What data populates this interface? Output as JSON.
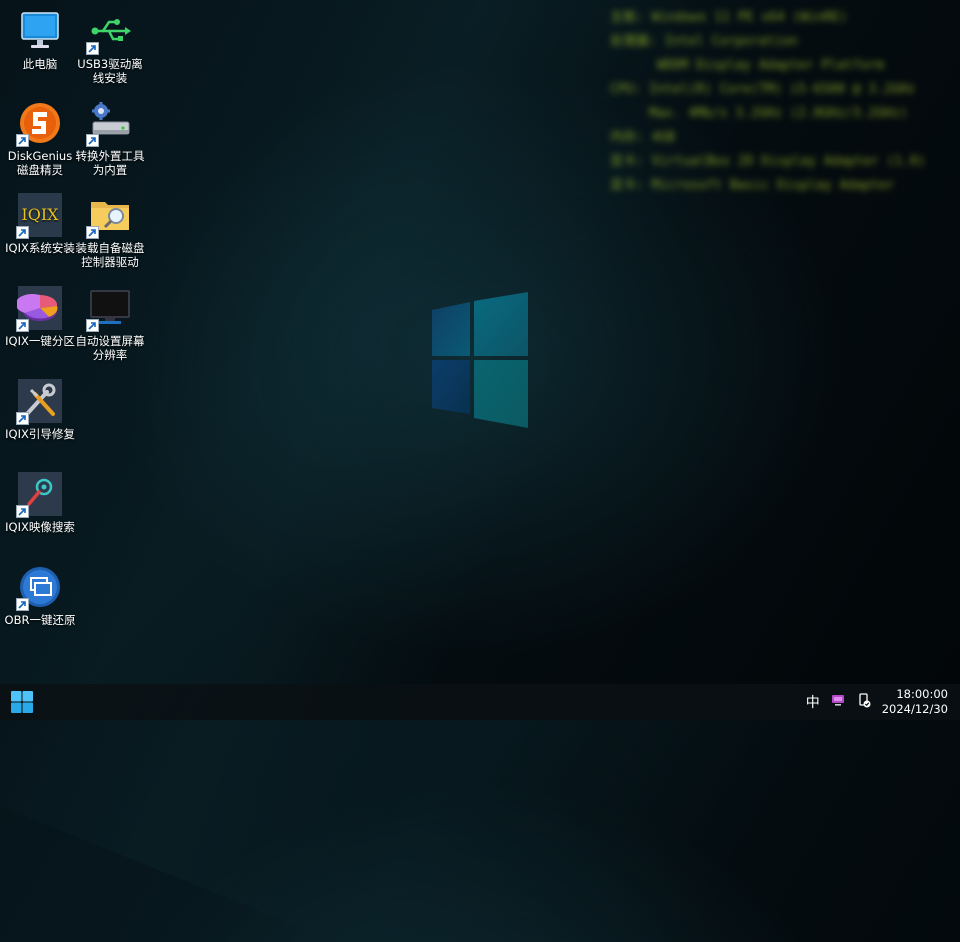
{
  "desktop": {
    "icons": [
      {
        "id": "this-pc",
        "label": "此电脑",
        "icon": "monitor-icon",
        "shortcut": false
      },
      {
        "id": "usb3",
        "label": "USB3驱动离\n线安装",
        "icon": "usb-icon",
        "shortcut": true
      },
      {
        "id": "diskgenius",
        "label": "DiskGenius\n磁盘精灵",
        "icon": "diskgenius-icon",
        "shortcut": true
      },
      {
        "id": "convert-external",
        "label": "转换外置工具\n为内置",
        "icon": "drive-gear-icon",
        "shortcut": true
      },
      {
        "id": "iqix-install",
        "label": "IQIX系统安装",
        "icon": "iqix-icon",
        "shortcut": true
      },
      {
        "id": "load-driver",
        "label": "装载自备磁盘\n控制器驱动",
        "icon": "folder-search-icon",
        "shortcut": true
      },
      {
        "id": "iqix-partition",
        "label": "IQIX一键分区",
        "icon": "pie-chart-icon",
        "shortcut": true
      },
      {
        "id": "auto-resolution",
        "label": "自动设置屏幕\n分辨率",
        "icon": "display-icon",
        "shortcut": true
      },
      {
        "id": "iqix-boot",
        "label": "IQIX引导修复",
        "icon": "tools-icon",
        "shortcut": true
      },
      {
        "id": "iqix-image",
        "label": "IQIX映像搜索",
        "icon": "image-search-icon",
        "shortcut": true
      },
      {
        "id": "obr",
        "label": "OBR一键还原",
        "icon": "restore-icon",
        "shortcut": true
      }
    ],
    "iqix_logo_text": "IQIX"
  },
  "sysinfo": {
    "lines": [
      "主板: Windows 11 PE x64 (WinRE)",
      "处理器: Intel Corporation",
      "      WDDM Display Adapter Platform",
      "CPU: Intel(R) Core(TM) i5-6500 @ 3.2GHz",
      "     Max. 4Mb/s 3.2GHz (2.8GHz/3.2GHz)",
      "内存: 4GB",
      "显卡: VirtualBox 2D Display Adapter (1.0)",
      "显卡: Microsoft Basic Display Adapter"
    ],
    "color": "#a8c82a"
  },
  "taskbar": {
    "start_icon": "windows-start-icon",
    "ime": "中",
    "tray_icons": [
      "network-display-icon",
      "usb-eject-icon"
    ],
    "time": "18:00:00",
    "date": "2024/12/30"
  }
}
